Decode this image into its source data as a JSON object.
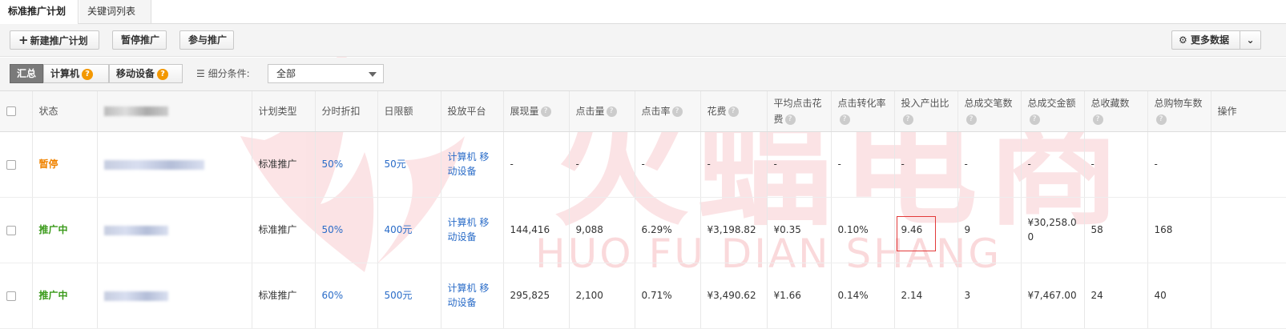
{
  "tabs": [
    {
      "label": "标准推广计划",
      "active": true
    },
    {
      "label": "关键词列表",
      "active": false
    }
  ],
  "toolbar": {
    "new_plan_label": "新建推广计划",
    "pause_label": "暂停推广",
    "join_label": "参与推广",
    "more_data_label": "更多数据"
  },
  "filters": {
    "segments": [
      {
        "label": "汇总",
        "active": true
      },
      {
        "label": "计算机",
        "active": false
      },
      {
        "label": "移动设备",
        "active": false
      }
    ],
    "condition_label": "细分条件:",
    "condition_value": "全部"
  },
  "columns": [
    "状态",
    "",
    "计划类型",
    "分时折扣",
    "日限额",
    "投放平台",
    "展现量",
    "点击量",
    "点击率",
    "花费",
    "平均点击花费",
    "点击转化率",
    "投入产出比",
    "总成交笔数",
    "总成交金额",
    "总收藏数",
    "总购物车数",
    "操作"
  ],
  "rows": [
    {
      "status": "暂停",
      "plan_type": "标准推广",
      "time_discount": "50%",
      "daily_limit": "50元",
      "platform": "计算机 移动设备",
      "impressions": "-",
      "clicks": "-",
      "ctr": "-",
      "cost": "-",
      "avg_cpc": "-",
      "cvr": "-",
      "roi": "-",
      "orders": "-",
      "gmv": "-",
      "favorites": "-",
      "cart": "-"
    },
    {
      "status": "推广中",
      "plan_type": "标准推广",
      "time_discount": "50%",
      "daily_limit": "400元",
      "platform": "计算机 移动设备",
      "impressions": "144,416",
      "clicks": "9,088",
      "ctr": "6.29%",
      "cost": "¥3,198.82",
      "avg_cpc": "¥0.35",
      "cvr": "0.10%",
      "roi": "9.46",
      "orders": "9",
      "gmv": "¥30,258.00",
      "favorites": "58",
      "cart": "168"
    },
    {
      "status": "推广中",
      "plan_type": "标准推广",
      "time_discount": "60%",
      "daily_limit": "500元",
      "platform": "计算机 移动设备",
      "impressions": "295,825",
      "clicks": "2,100",
      "ctr": "0.71%",
      "cost": "¥3,490.62",
      "avg_cpc": "¥1.66",
      "cvr": "0.14%",
      "roi": "2.14",
      "orders": "3",
      "gmv": "¥7,467.00",
      "favorites": "24",
      "cart": "40"
    }
  ],
  "watermark": {
    "cn": "火蝠电商",
    "en": "HUO FU DIAN SHANG",
    "color": "#e8323c"
  },
  "colors": {
    "paused": "#f08300",
    "running": "#3a9a1a",
    "link": "#2a6cc8",
    "help": "#f39800"
  }
}
